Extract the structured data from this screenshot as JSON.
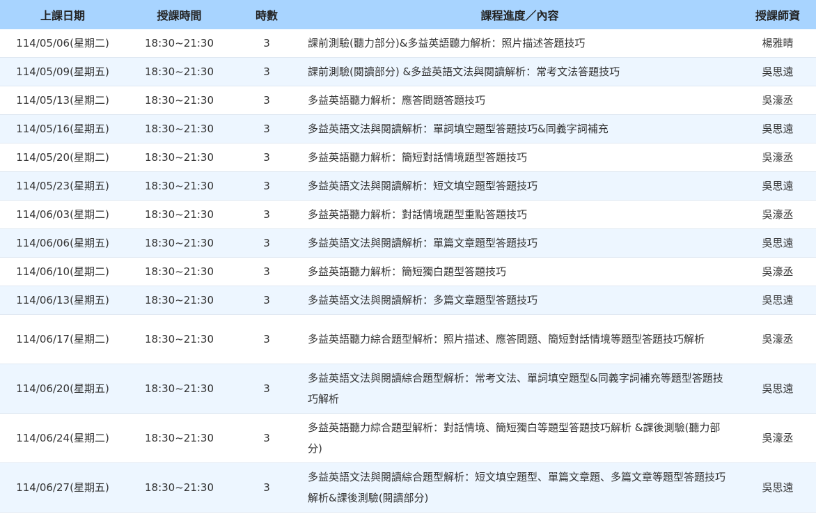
{
  "table": {
    "headers": {
      "date": "上課日期",
      "time": "授課時間",
      "hours": "時數",
      "content": "課程進度／內容",
      "teacher": "授課師資"
    },
    "rows": [
      {
        "date": "114/05/06(星期二)",
        "time": "18:30~21:30",
        "hours": "3",
        "content": "課前測驗(聽力部分)&多益英語聽力解析：照片描述答題技巧",
        "teacher": "楊雅晴"
      },
      {
        "date": "114/05/09(星期五)",
        "time": "18:30~21:30",
        "hours": "3",
        "content": "課前測驗(閱讀部分) &多益英語文法與閱讀解析：常考文法答題技巧",
        "teacher": "吳思遠"
      },
      {
        "date": "114/05/13(星期二)",
        "time": "18:30~21:30",
        "hours": "3",
        "content": "多益英語聽力解析：應答問題答題技巧",
        "teacher": "吳濠丞"
      },
      {
        "date": "114/05/16(星期五)",
        "time": "18:30~21:30",
        "hours": "3",
        "content": "多益英語文法與閱讀解析：單詞填空題型答題技巧&同義字詞補充",
        "teacher": "吳思遠"
      },
      {
        "date": "114/05/20(星期二)",
        "time": "18:30~21:30",
        "hours": "3",
        "content": "多益英語聽力解析：簡短對話情境題型答題技巧",
        "teacher": "吳濠丞"
      },
      {
        "date": "114/05/23(星期五)",
        "time": "18:30~21:30",
        "hours": "3",
        "content": "多益英語文法與閱讀解析：短文填空題型答題技巧",
        "teacher": "吳思遠"
      },
      {
        "date": "114/06/03(星期二)",
        "time": "18:30~21:30",
        "hours": "3",
        "content": "多益英語聽力解析：對話情境題型重點答題技巧",
        "teacher": "吳濠丞"
      },
      {
        "date": "114/06/06(星期五)",
        "time": "18:30~21:30",
        "hours": "3",
        "content": "多益英語文法與閱讀解析：單篇文章題型答題技巧",
        "teacher": "吳思遠"
      },
      {
        "date": "114/06/10(星期二)",
        "time": "18:30~21:30",
        "hours": "3",
        "content": "多益英語聽力解析：簡短獨白題型答題技巧",
        "teacher": "吳濠丞"
      },
      {
        "date": "114/06/13(星期五)",
        "time": "18:30~21:30",
        "hours": "3",
        "content": "多益英語文法與閱讀解析：多篇文章題型答題技巧",
        "teacher": "吳思遠"
      },
      {
        "date": "114/06/17(星期二)",
        "time": "18:30~21:30",
        "hours": "3",
        "content": "多益英語聽力綜合題型解析：照片描述、應答問題、簡短對話情境等題型答題技巧解析",
        "teacher": "吳濠丞"
      },
      {
        "date": "114/06/20(星期五)",
        "time": "18:30~21:30",
        "hours": "3",
        "content": "多益英語文法與閱讀綜合題型解析：常考文法、單詞填空題型&同義字詞補充等題型答題技巧解析",
        "teacher": "吳思遠"
      },
      {
        "date": "114/06/24(星期二)",
        "time": "18:30~21:30",
        "hours": "3",
        "content": "多益英語聽力綜合題型解析：對話情境、簡短獨白等題型答題技巧解析 &課後測驗(聽力部分)",
        "teacher": "吳濠丞"
      },
      {
        "date": "114/06/27(星期五)",
        "time": "18:30~21:30",
        "hours": "3",
        "content": "多益英語文法與閱讀綜合題型解析：短文填空題型、單篇文章題、多篇文章等題型答題技巧解析&課後測驗(閱讀部分)",
        "teacher": "吳思遠"
      }
    ]
  },
  "colors": {
    "header_bg": "#a8d4ff",
    "row_alt_bg": "#edf6ff",
    "row_bg": "#ffffff",
    "text": "#333333"
  }
}
